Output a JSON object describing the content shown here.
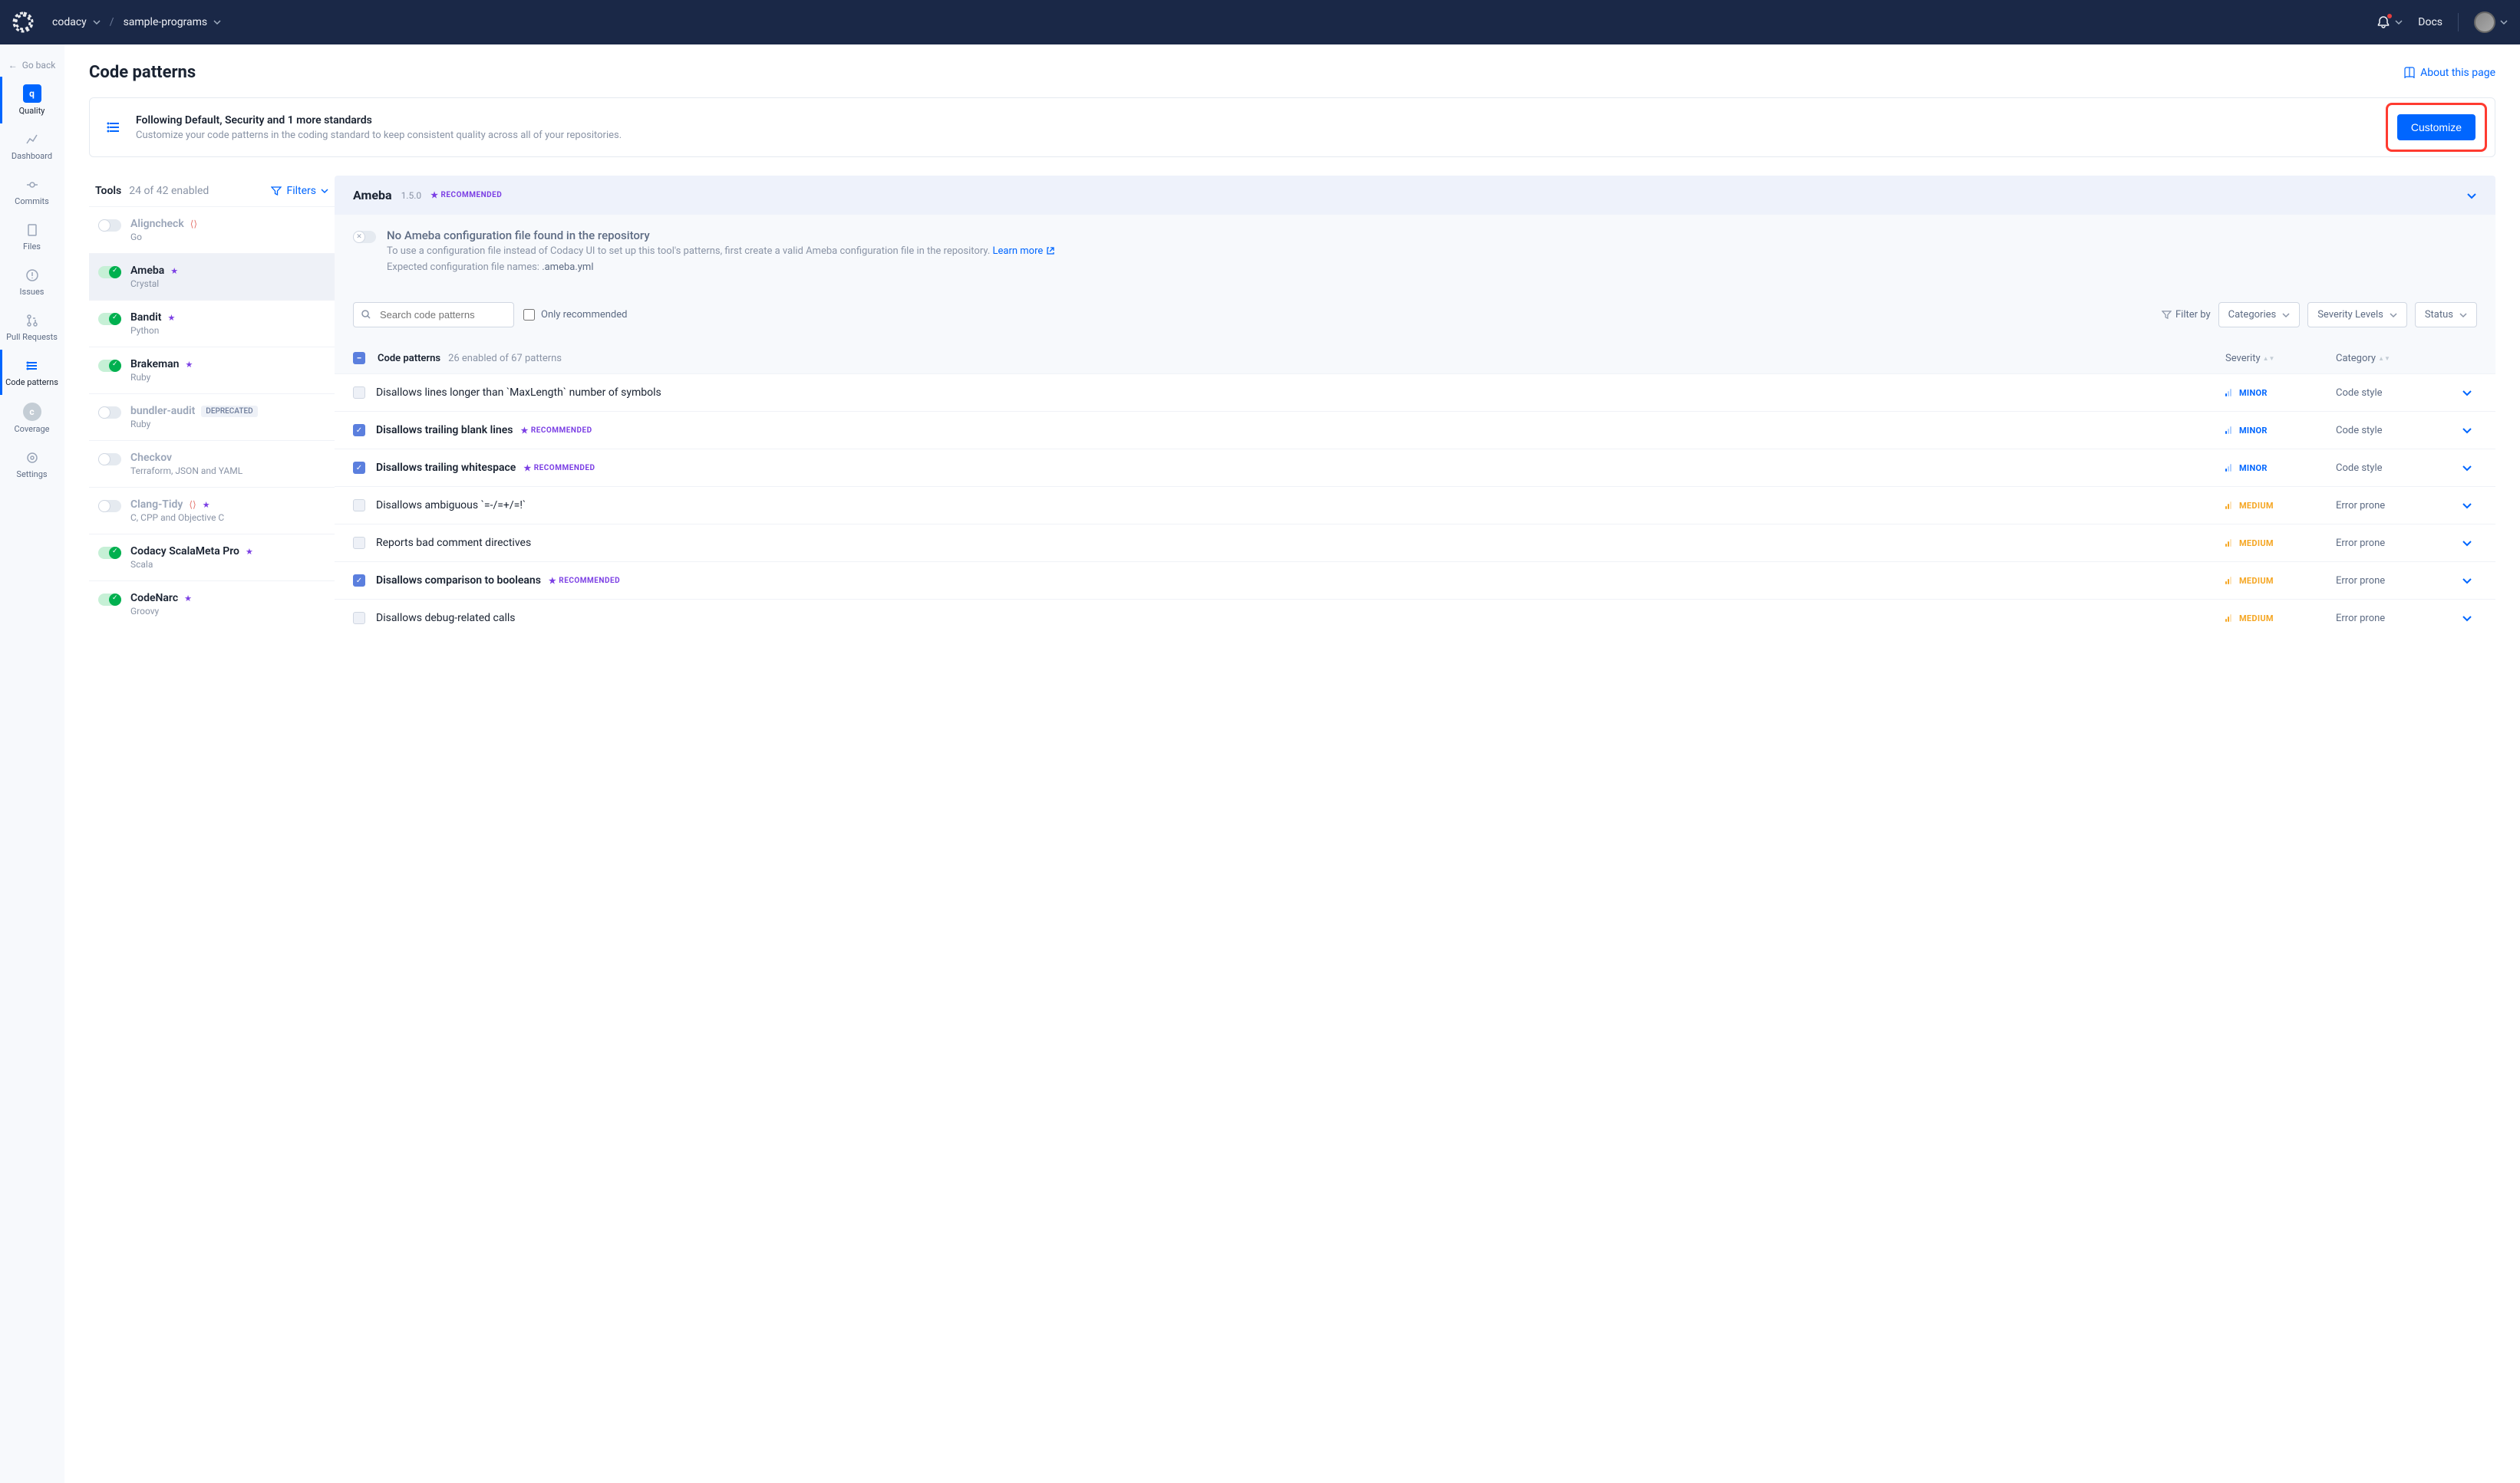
{
  "header": {
    "org": "codacy",
    "repo": "sample-programs",
    "docs_label": "Docs"
  },
  "sidebar": {
    "go_back": "Go back",
    "items": [
      {
        "label": "Quality",
        "key": "quality"
      },
      {
        "label": "Dashboard",
        "key": "dashboard"
      },
      {
        "label": "Commits",
        "key": "commits"
      },
      {
        "label": "Files",
        "key": "files"
      },
      {
        "label": "Issues",
        "key": "issues"
      },
      {
        "label": "Pull Requests",
        "key": "pull-requests"
      },
      {
        "label": "Code patterns",
        "key": "code-patterns"
      },
      {
        "label": "Coverage",
        "key": "coverage"
      },
      {
        "label": "Settings",
        "key": "settings"
      }
    ]
  },
  "page": {
    "title": "Code patterns",
    "about_link": "About this page"
  },
  "banner": {
    "title": "Following Default, Security and 1 more standards",
    "desc": "Customize your code patterns in the coding standard to keep consistent quality across all of your repositories.",
    "button": "Customize"
  },
  "tools_panel": {
    "title": "Tools",
    "count": "24 of 42 enabled",
    "filters_label": "Filters",
    "tools": [
      {
        "name": "Aligncheck",
        "lang": "Go",
        "on": false,
        "disabled": true,
        "autofix": true
      },
      {
        "name": "Ameba",
        "lang": "Crystal",
        "on": true,
        "star": true,
        "selected": true
      },
      {
        "name": "Bandit",
        "lang": "Python",
        "on": true,
        "star": true
      },
      {
        "name": "Brakeman",
        "lang": "Ruby",
        "on": true,
        "star": true
      },
      {
        "name": "bundler-audit",
        "lang": "Ruby",
        "on": false,
        "disabled": true,
        "deprecated": true
      },
      {
        "name": "Checkov",
        "lang": "Terraform, JSON and YAML",
        "on": false,
        "disabled": true
      },
      {
        "name": "Clang-Tidy",
        "lang": "C, CPP and Objective C",
        "on": false,
        "disabled": true,
        "autofix": true,
        "star": true
      },
      {
        "name": "Codacy ScalaMeta Pro",
        "lang": "Scala",
        "on": true,
        "star": true
      },
      {
        "name": "CodeNarc",
        "lang": "Groovy",
        "on": true,
        "star": true
      }
    ]
  },
  "patterns_panel": {
    "tool_name": "Ameba",
    "version": "1.5.0",
    "recommended_label": "RECOMMENDED",
    "config_notice": {
      "title": "No Ameba configuration file found in the repository",
      "desc": "To use a configuration file instead of Codacy UI to set up this tool's patterns, first create a valid Ameba configuration file in the repository.",
      "learn_more": "Learn more",
      "expected_prefix": "Expected configuration file names: ",
      "expected_file": ".ameba.yml"
    },
    "controls": {
      "search_placeholder": "Search code patterns",
      "only_recommended": "Only recommended",
      "filter_by": "Filter by",
      "categories": "Categories",
      "severity_levels": "Severity Levels",
      "status": "Status"
    },
    "table_header": {
      "name": "Code patterns",
      "count": "26 enabled of 67 patterns",
      "severity": "Severity",
      "category": "Category"
    },
    "patterns": [
      {
        "name": "Disallows lines longer than `MaxLength` number of symbols",
        "checked": false,
        "severity": "MINOR",
        "severity_key": "minor",
        "category": "Code style"
      },
      {
        "name": "Disallows trailing blank lines",
        "checked": true,
        "bold": true,
        "recommended": true,
        "severity": "MINOR",
        "severity_key": "minor",
        "category": "Code style"
      },
      {
        "name": "Disallows trailing whitespace",
        "checked": true,
        "bold": true,
        "recommended": true,
        "severity": "MINOR",
        "severity_key": "minor",
        "category": "Code style"
      },
      {
        "name": "Disallows ambiguous `=-/=+/=!`",
        "checked": false,
        "severity": "MEDIUM",
        "severity_key": "medium",
        "category": "Error prone"
      },
      {
        "name": "Reports bad comment directives",
        "checked": false,
        "severity": "MEDIUM",
        "severity_key": "medium",
        "category": "Error prone"
      },
      {
        "name": "Disallows comparison to booleans",
        "checked": true,
        "bold": true,
        "recommended": true,
        "severity": "MEDIUM",
        "severity_key": "medium",
        "category": "Error prone"
      },
      {
        "name": "Disallows debug-related calls",
        "checked": false,
        "severity": "MEDIUM",
        "severity_key": "medium",
        "category": "Error prone"
      }
    ]
  },
  "labels": {
    "deprecated": "DEPRECATED"
  }
}
